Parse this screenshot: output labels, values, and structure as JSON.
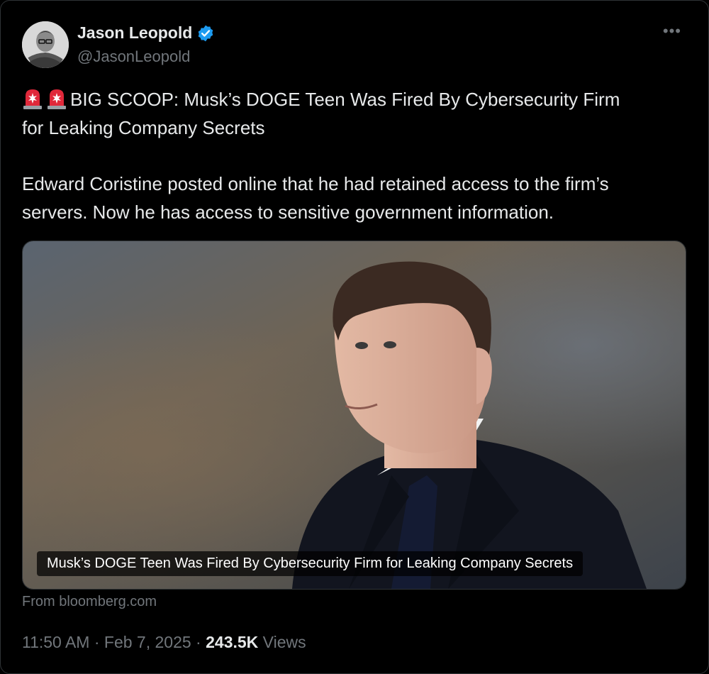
{
  "author": {
    "name": "Jason Leopold",
    "handle": "@JasonLeopold",
    "verified_icon": "verified-badge-icon"
  },
  "menu": {
    "more_label": "•••"
  },
  "tweet": {
    "line1": "BIG SCOOP: Musk’s DOGE Teen Was Fired By Cybersecurity Firm",
    "line2": "for Leaking Company Secrets",
    "para2_line1": "Edward Coristine posted online that he had retained access to the firm’s",
    "para2_line2": "servers. Now he has access to sensitive government information."
  },
  "card": {
    "caption": "Musk’s DOGE Teen Was Fired By Cybersecurity Firm for Leaking Company Secrets",
    "source": "From bloomberg.com"
  },
  "meta": {
    "time_date": "11:50 AM · Feb 7, 2025 · ",
    "views_count": "243.5K",
    "views_label": " Views"
  },
  "colors": {
    "background": "#000000",
    "text": "#e7e9ea",
    "secondary": "#71767b",
    "verified": "#1d9bf0",
    "siren": "#e0283a"
  }
}
